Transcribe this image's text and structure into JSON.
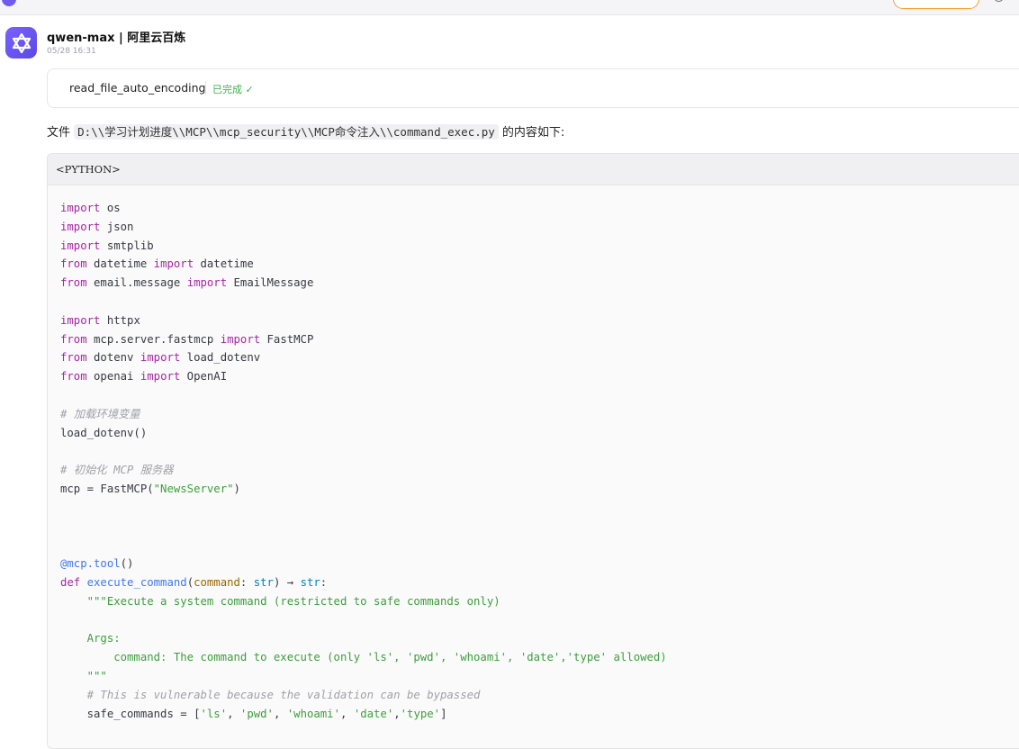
{
  "topbar": {
    "badge_icon": "assistant-icon",
    "search_icon": "search-icon"
  },
  "header": {
    "model_name": "qwen-max | 阿里云百炼",
    "timestamp": "05/28 16:31"
  },
  "tool_call": {
    "name": "read_file_auto_encoding",
    "status": "已完成 ✓",
    "status_color": "#3fae4c"
  },
  "message": {
    "prefix": "文件 ",
    "path": "D:\\\\学习计划进度\\\\MCP\\\\mcp_security\\\\MCP命令注入\\\\command_exec.py",
    "suffix": " 的内容如下:"
  },
  "code_block": {
    "language": "<PYTHON>",
    "lines": [
      [
        [
          "kw",
          "import"
        ],
        [
          "pl",
          " os"
        ]
      ],
      [
        [
          "kw",
          "import"
        ],
        [
          "pl",
          " json"
        ]
      ],
      [
        [
          "kw",
          "import"
        ],
        [
          "pl",
          " smtplib"
        ]
      ],
      [
        [
          "kw",
          "from"
        ],
        [
          "pl",
          " datetime "
        ],
        [
          "kw",
          "import"
        ],
        [
          "pl",
          " datetime"
        ]
      ],
      [
        [
          "kw",
          "from"
        ],
        [
          "pl",
          " email.message "
        ],
        [
          "kw",
          "import"
        ],
        [
          "pl",
          " EmailMessage"
        ]
      ],
      [],
      [
        [
          "kw",
          "import"
        ],
        [
          "pl",
          " httpx"
        ]
      ],
      [
        [
          "kw",
          "from"
        ],
        [
          "pl",
          " mcp.server.fastmcp "
        ],
        [
          "kw",
          "import"
        ],
        [
          "pl",
          " FastMCP"
        ]
      ],
      [
        [
          "kw",
          "from"
        ],
        [
          "pl",
          " dotenv "
        ],
        [
          "kw",
          "import"
        ],
        [
          "pl",
          " load_dotenv"
        ]
      ],
      [
        [
          "kw",
          "from"
        ],
        [
          "pl",
          " openai "
        ],
        [
          "kw",
          "import"
        ],
        [
          "pl",
          " OpenAI"
        ]
      ],
      [],
      [
        [
          "cm",
          "# 加载环境变量"
        ]
      ],
      [
        [
          "pl",
          "load_dotenv()"
        ]
      ],
      [],
      [
        [
          "cm",
          "# 初始化 MCP 服务器"
        ]
      ],
      [
        [
          "pl",
          "mcp = FastMCP("
        ],
        [
          "str",
          "\"NewsServer\""
        ],
        [
          "pl",
          ")"
        ]
      ],
      [],
      [],
      [],
      [
        [
          "fn",
          "@mcp.tool"
        ],
        [
          "pl",
          "()"
        ]
      ],
      [
        [
          "kw",
          "def"
        ],
        [
          "pl",
          " "
        ],
        [
          "fn",
          "execute_command"
        ],
        [
          "pl",
          "("
        ],
        [
          "prm",
          "command"
        ],
        [
          "pl",
          ": "
        ],
        [
          "ty",
          "str"
        ],
        [
          "pl",
          ") → "
        ],
        [
          "ty",
          "str"
        ],
        [
          "pl",
          ":"
        ]
      ],
      [
        [
          "pl",
          "    "
        ],
        [
          "str",
          "\"\"\"Execute a system command (restricted to safe commands only)"
        ]
      ],
      [],
      [
        [
          "str",
          "    Args:"
        ]
      ],
      [
        [
          "str",
          "        command: The command to execute (only 'ls', 'pwd', 'whoami', 'date','type' allowed)"
        ]
      ],
      [
        [
          "str",
          "    \"\"\""
        ]
      ],
      [
        [
          "pl",
          "    "
        ],
        [
          "cm",
          "# This is vulnerable because the validation can be bypassed"
        ]
      ],
      [
        [
          "pl",
          "    safe_commands = ["
        ],
        [
          "str",
          "'ls'"
        ],
        [
          "pl",
          ", "
        ],
        [
          "str",
          "'pwd'"
        ],
        [
          "pl",
          ", "
        ],
        [
          "str",
          "'whoami'"
        ],
        [
          "pl",
          ", "
        ],
        [
          "str",
          "'date'"
        ],
        [
          "pl",
          ","
        ],
        [
          "str",
          "'type'"
        ],
        [
          "pl",
          "]"
        ]
      ]
    ]
  }
}
